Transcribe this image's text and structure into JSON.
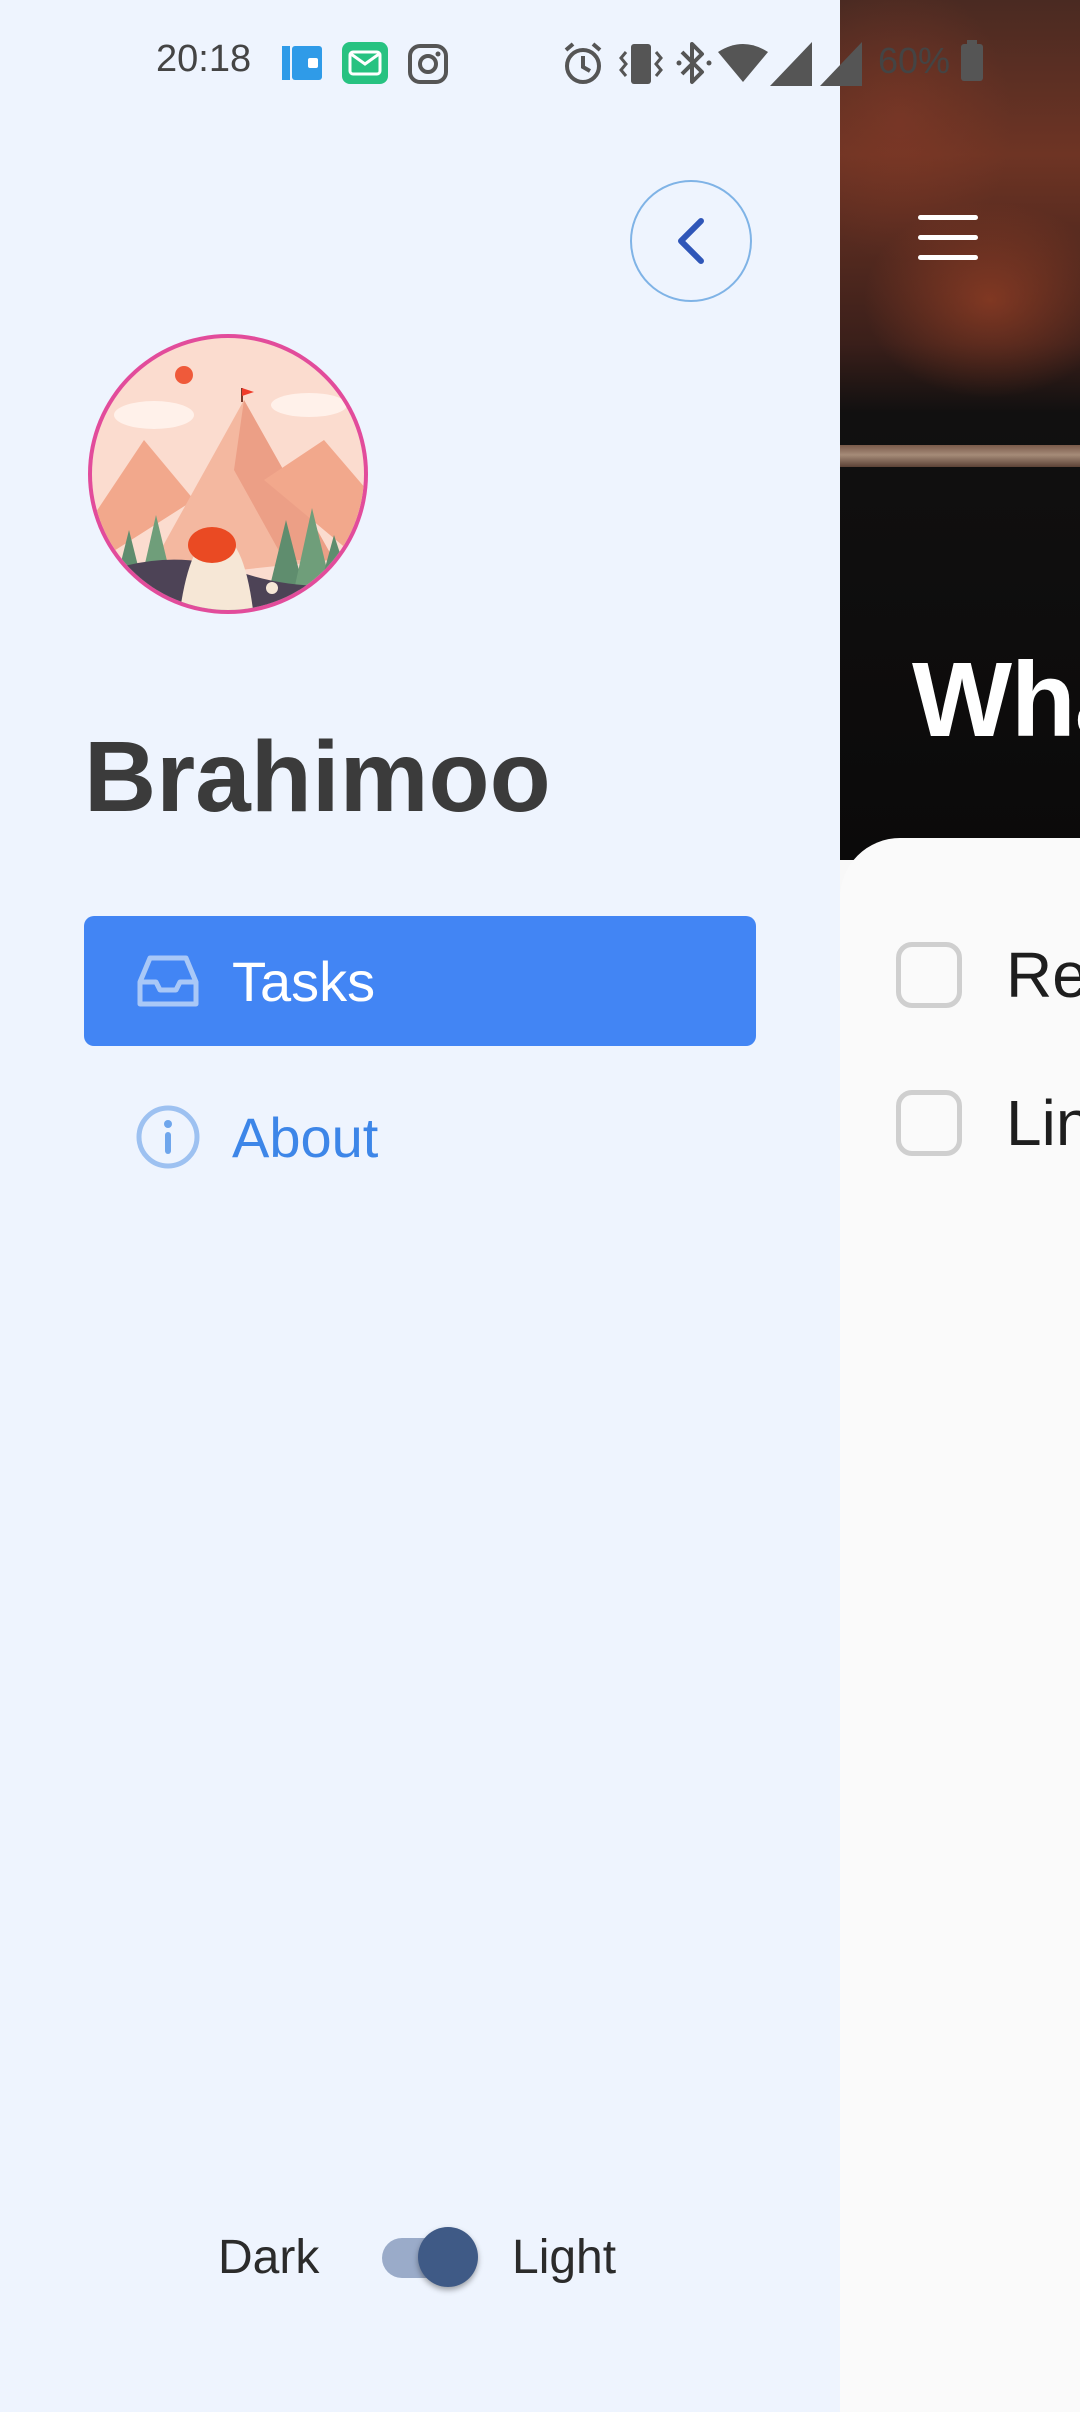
{
  "status_bar": {
    "time": "20:18",
    "battery": "60%",
    "left_icons": [
      "wallet-icon",
      "mail-app-icon",
      "instagram-icon"
    ],
    "right_icons": [
      "alarm-icon",
      "vibrate-icon",
      "bluetooth-icon",
      "wifi-icon",
      "signal-icon",
      "signal-icon",
      "battery-icon"
    ]
  },
  "drawer": {
    "user_name": "Brahimoo",
    "nav": [
      {
        "label": "Tasks",
        "icon": "inbox-icon",
        "active": true
      },
      {
        "label": "About",
        "icon": "info-icon",
        "active": false
      }
    ],
    "theme_toggle": {
      "left_label": "Dark",
      "right_label": "Light",
      "selected": "Light"
    }
  },
  "main": {
    "header_title": "Wha",
    "tasks": [
      {
        "text": "Re",
        "checked": false
      },
      {
        "text": "Lin",
        "checked": false
      }
    ]
  },
  "colors": {
    "drawer_bg": "#eef4fe",
    "accent": "#4285f4",
    "nav_inactive": "#3d86e8",
    "avatar_ring": "#e24c9b",
    "toggle_thumb": "#3f5a86"
  }
}
